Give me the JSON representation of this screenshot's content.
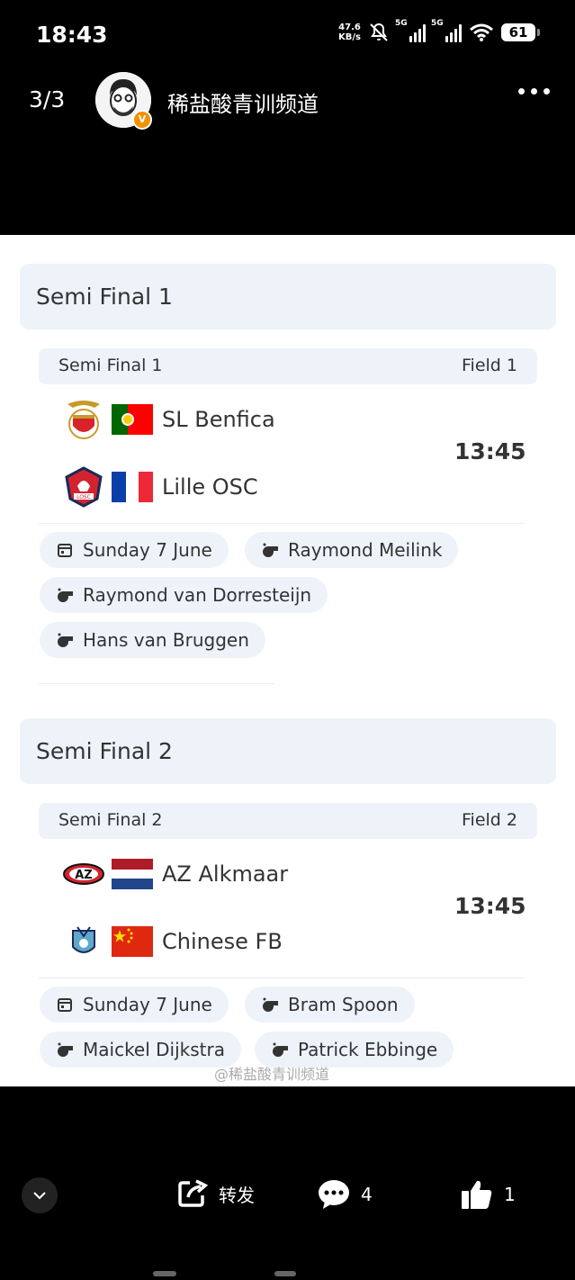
{
  "status_bar": {
    "time": "18:43",
    "net_speed_value": "47.6",
    "net_speed_unit": "KB/s",
    "signal1_label": "5G",
    "signal2_label": "5G",
    "battery": "61",
    "icons": [
      "mute-bell-icon",
      "signal-5g-icon",
      "signal-5g-icon",
      "wifi-icon",
      "battery-icon"
    ]
  },
  "header": {
    "page_counter": "3/3",
    "channel_name": "稀盐酸青训频道",
    "verified_badge": "V"
  },
  "semi_finals": [
    {
      "section_title": "Semi Final 1",
      "match_label": "Semi Final 1",
      "field": "Field 1",
      "kickoff": "13:45",
      "teams": [
        {
          "name": "SL Benfica",
          "crest": "benfica-crest-icon",
          "flag": "portugal-flag"
        },
        {
          "name": "Lille OSC",
          "crest": "lille-crest-icon",
          "flag": "france-flag"
        }
      ],
      "date": "Sunday 7 June",
      "officials": [
        "Raymond Meilink",
        "Raymond van Dorresteijn",
        "Hans van Bruggen"
      ]
    },
    {
      "section_title": "Semi Final 2",
      "match_label": "Semi Final 2",
      "field": "Field 2",
      "kickoff": "13:45",
      "teams": [
        {
          "name": "AZ Alkmaar",
          "crest": "az-crest-icon",
          "flag": "netherlands-flag"
        },
        {
          "name": "Chinese FB",
          "crest": "chinese-fb-crest-icon",
          "flag": "china-flag"
        }
      ],
      "date": "Sunday 7 June",
      "officials": [
        "Bram Spoon",
        "Maickel Dijkstra",
        "Patrick Ebbinge"
      ]
    }
  ],
  "watermark": "@稀盐酸青训频道",
  "bottom_bar": {
    "share_label": "转发",
    "comment_count": "4",
    "like_count": "1"
  },
  "colors": {
    "chip_bg": "#eef3fa",
    "text": "#333333",
    "badge": "#f29100"
  }
}
